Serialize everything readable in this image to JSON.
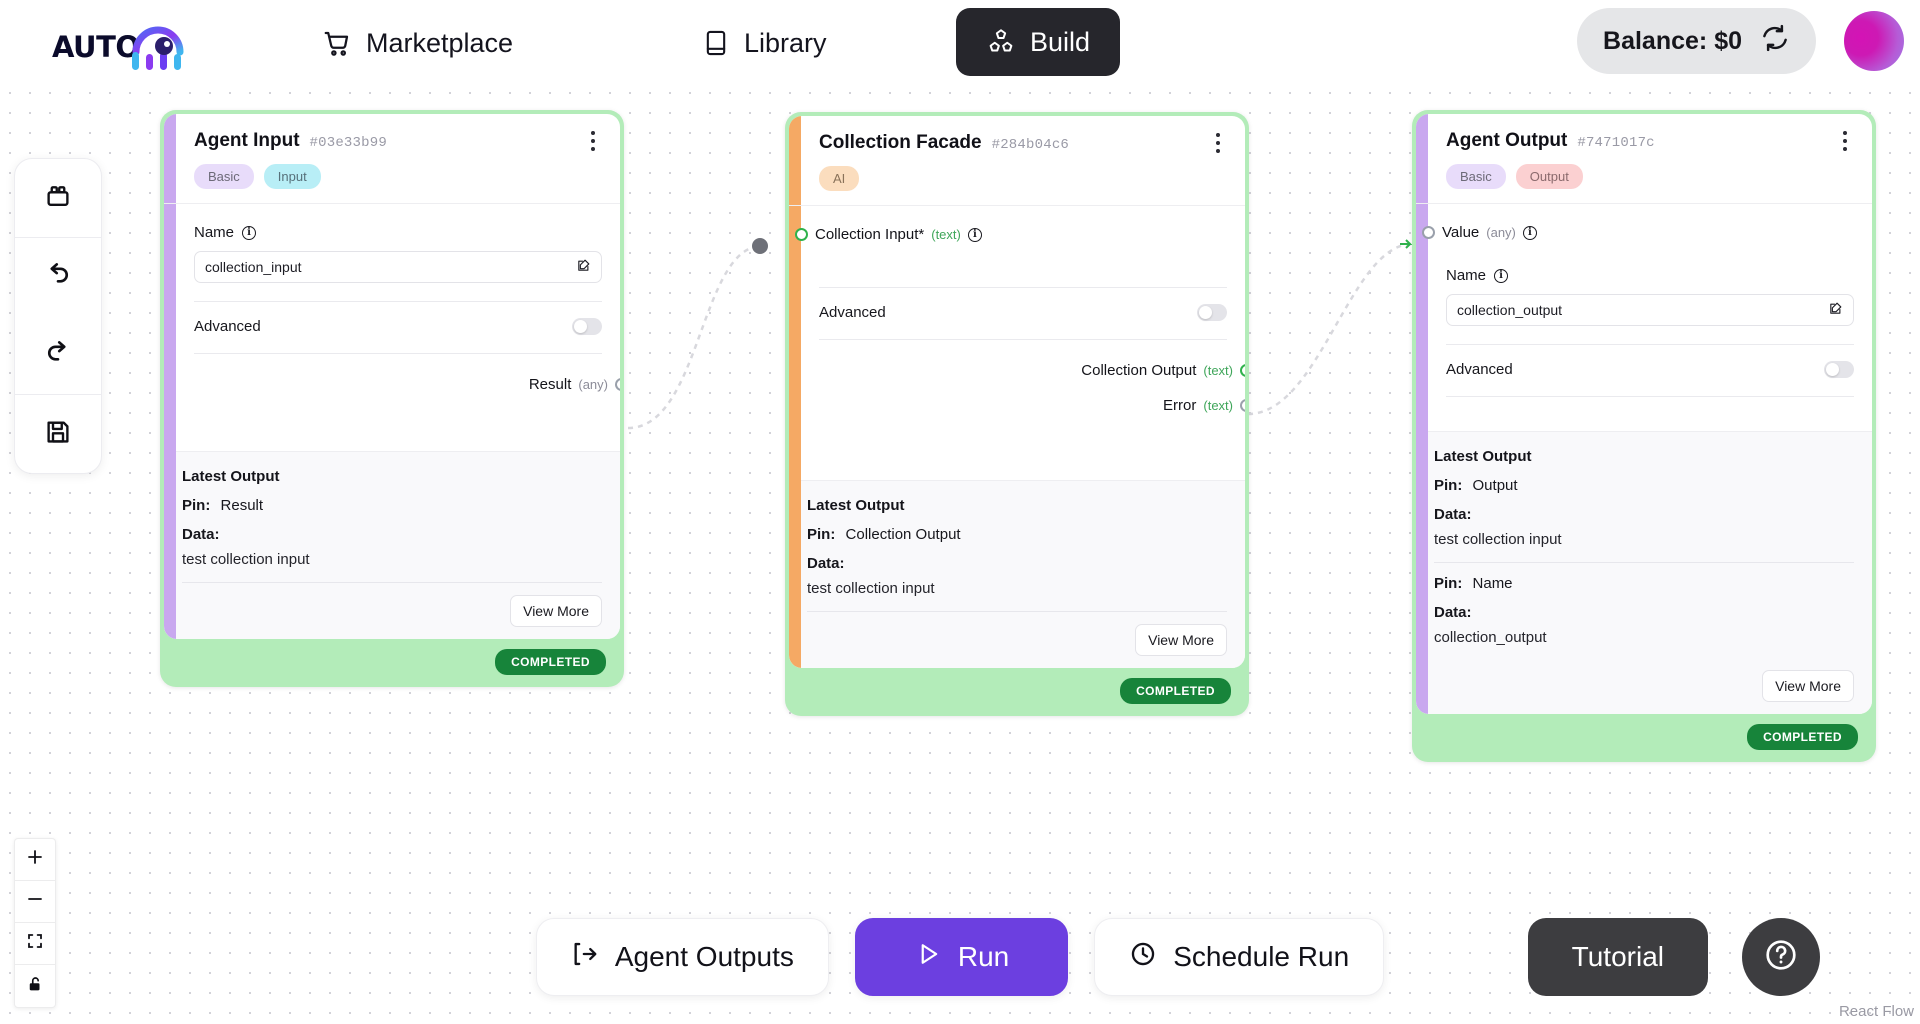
{
  "app": {
    "logo_text": "AUTO",
    "logo_icon": "autogpt-mark-icon"
  },
  "header": {
    "nav": [
      {
        "label": "Marketplace",
        "icon": "shopping-cart-icon",
        "active": false
      },
      {
        "label": "Library",
        "icon": "book-icon",
        "active": false
      },
      {
        "label": "Build",
        "icon": "blocks-icon",
        "active": true
      }
    ],
    "balance": {
      "label": "Balance: $0",
      "refresh_icon": "refresh-icon"
    },
    "avatar": {
      "icon": "avatar"
    }
  },
  "rail": {
    "items": [
      {
        "name": "blocks",
        "icon": "blocks-icon"
      },
      {
        "name": "undo",
        "icon": "undo-icon"
      },
      {
        "name": "redo",
        "icon": "redo-icon"
      },
      {
        "name": "save",
        "icon": "save-icon"
      }
    ]
  },
  "zoom_controls": {
    "items": [
      {
        "name": "zoom-in",
        "icon": "plus-icon"
      },
      {
        "name": "zoom-out",
        "icon": "minus-icon"
      },
      {
        "name": "fit-view",
        "icon": "fit-view-icon"
      },
      {
        "name": "lock",
        "icon": "unlock-icon"
      }
    ]
  },
  "nodes": [
    {
      "title": "Agent Input",
      "id": "#03e33b99",
      "accent": "purple",
      "pills": [
        {
          "label": "Basic",
          "style": "basic"
        },
        {
          "label": "Input",
          "style": "input"
        }
      ],
      "fields": [
        {
          "label": "Name",
          "value": "collection_input"
        }
      ],
      "advanced_label": "Advanced",
      "outputs": [
        {
          "label": "Result",
          "type": "(any)",
          "connected": false
        }
      ],
      "latest": {
        "heading": "Latest Output",
        "entries": [
          {
            "pin_label": "Pin:",
            "pin": "Result",
            "data_label": "Data:",
            "data": "test collection input"
          }
        ],
        "view_more": "View More"
      },
      "status": "COMPLETED"
    },
    {
      "title": "Collection Facade",
      "id": "#284b04c6",
      "accent": "orange",
      "pills": [
        {
          "label": "AI",
          "style": "ai"
        }
      ],
      "inputs": [
        {
          "label": "Collection Input*",
          "type": "(text)",
          "connected": true
        }
      ],
      "advanced_label": "Advanced",
      "outputs": [
        {
          "label": "Collection Output",
          "type": "(text)",
          "connected": true
        },
        {
          "label": "Error",
          "type": "(text)",
          "connected": false
        }
      ],
      "latest": {
        "heading": "Latest Output",
        "entries": [
          {
            "pin_label": "Pin:",
            "pin": "Collection Output",
            "data_label": "Data:",
            "data": "test collection input"
          }
        ],
        "view_more": "View More"
      },
      "status": "COMPLETED"
    },
    {
      "title": "Agent Output",
      "id": "#7471017c",
      "accent": "purple",
      "pills": [
        {
          "label": "Basic",
          "style": "basic"
        },
        {
          "label": "Output",
          "style": "output"
        }
      ],
      "inputs": [
        {
          "label": "Value",
          "type": "(any)",
          "connected": true
        }
      ],
      "fields": [
        {
          "label": "Name",
          "value": "collection_output"
        }
      ],
      "advanced_label": "Advanced",
      "latest": {
        "heading": "Latest Output",
        "entries": [
          {
            "pin_label": "Pin:",
            "pin": "Output",
            "data_label": "Data:",
            "data": "test collection input"
          },
          {
            "pin_label": "Pin:",
            "pin": "Name",
            "data_label": "Data:",
            "data": "collection_output"
          }
        ],
        "view_more": "View More"
      },
      "status": "COMPLETED"
    }
  ],
  "actions": {
    "agent_outputs": {
      "label": "Agent Outputs",
      "icon": "log-out-icon"
    },
    "run": {
      "label": "Run",
      "icon": "play-icon"
    },
    "schedule": {
      "label": "Schedule Run",
      "icon": "clock-icon"
    },
    "tutorial": {
      "label": "Tutorial"
    },
    "help": {
      "icon": "question-mark-icon"
    }
  },
  "attribution": "React Flow",
  "colors": {
    "accent_purple": "#c9a8ef",
    "accent_orange": "#f5a964",
    "run_button": "#6c3fe0",
    "status_green": "#17843a",
    "node_shell_green": "#b3ecb9",
    "handle_connected": "#2fb24c"
  }
}
